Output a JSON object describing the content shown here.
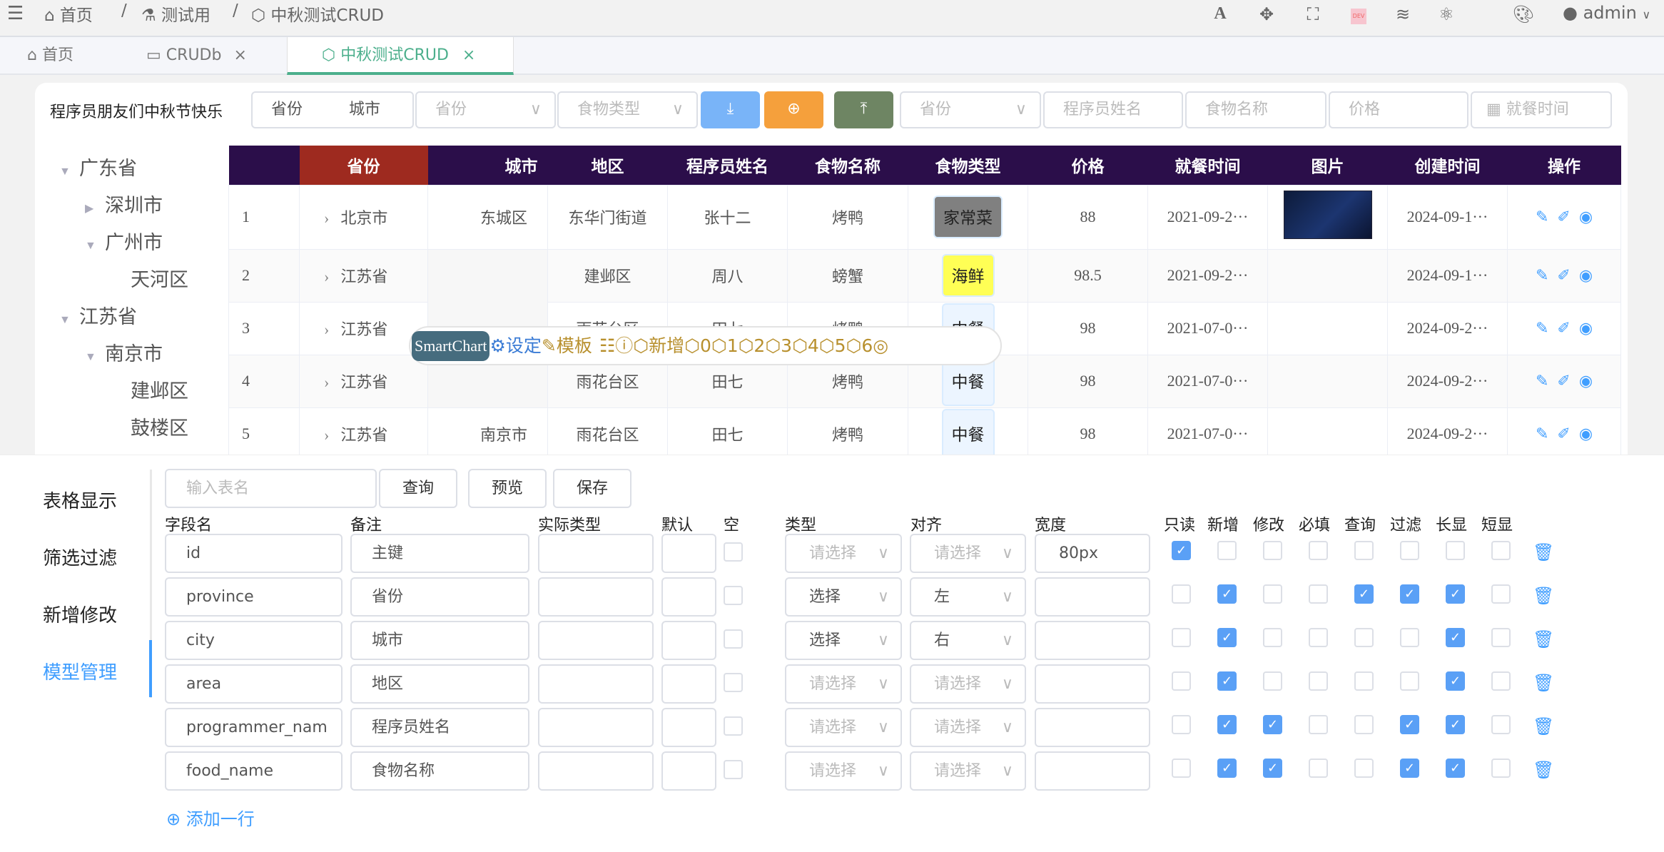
{
  "topbar": {
    "breadcrumb": [
      {
        "label": "首页",
        "icon": "home-icon"
      },
      {
        "label": "测试用",
        "icon": "flask-icon"
      },
      {
        "label": "中秋测试CRUD",
        "icon": "hexagon-icon"
      }
    ],
    "separator": "/",
    "user": "admin",
    "dev_badge": "DEV"
  },
  "tabs": [
    {
      "label": "首页",
      "icon": "home-icon"
    },
    {
      "label": "CRUDb",
      "icon": "monitor-icon",
      "close": "×"
    },
    {
      "label": "中秋测试CRUD",
      "icon": "hexagon-icon",
      "close": "×",
      "active": true
    }
  ],
  "filter": {
    "title": "程序员朋友们中秋节快乐",
    "seg": [
      "省份",
      "城市"
    ],
    "province_select": "省份",
    "food_type_select": "食物类型",
    "province_select2": "省份",
    "programmer_placeholder": "程序员姓名",
    "food_placeholder": "食物名称",
    "price_placeholder": "价格",
    "date_placeholder": "就餐时间",
    "colors": {
      "download": "#79b4f8",
      "add": "#f5a03c",
      "upload": "#6e8563"
    }
  },
  "tree": [
    {
      "label": "广东省",
      "level": 0,
      "arrow": "down"
    },
    {
      "label": "深圳市",
      "level": 1,
      "arrow": "right"
    },
    {
      "label": "广州市",
      "level": 1,
      "arrow": "down"
    },
    {
      "label": "天河区",
      "level": 2
    },
    {
      "label": "江苏省",
      "level": 0,
      "arrow": "down"
    },
    {
      "label": "南京市",
      "level": 1,
      "arrow": "down"
    },
    {
      "label": "建邺区",
      "level": 2
    },
    {
      "label": "鼓楼区",
      "level": 2
    }
  ],
  "table": {
    "headers": [
      "",
      "省份",
      "城市",
      "地区",
      "程序员姓名",
      "食物名称",
      "食物类型",
      "价格",
      "就餐时间",
      "图片",
      "创建时间",
      "操作"
    ],
    "header_color": "#2b0e4a",
    "province_header_color": "#9e2a1f",
    "rows": [
      {
        "idx": "1",
        "province": "北京市",
        "city": "东城区",
        "area": "东华门街道",
        "name": "张十二",
        "food": "烤鸭",
        "type": "家常菜",
        "type_color": "#808080",
        "price": "88",
        "meal": "2021-09-2···",
        "image": true,
        "created": "2024-09-1···"
      },
      {
        "idx": "2",
        "province": "江苏省",
        "city": "",
        "area": "建邺区",
        "name": "周八",
        "food": "螃蟹",
        "type": "海鲜",
        "type_color": "#ffff55",
        "price": "98.5",
        "meal": "2021-09-2···",
        "image": false,
        "created": "2024-09-1···"
      },
      {
        "idx": "3",
        "province": "江苏省",
        "city": "",
        "area": "雨花台区",
        "name": "田七",
        "food": "烤鸭",
        "type": "中餐",
        "type_color": "#ecf5ff",
        "price": "98",
        "meal": "2021-07-0···",
        "image": false,
        "created": "2024-09-2···"
      },
      {
        "idx": "4",
        "province": "江苏省",
        "city": "",
        "area": "雨花台区",
        "name": "田七",
        "food": "烤鸭",
        "type": "中餐",
        "type_color": "#ecf5ff",
        "price": "98",
        "meal": "2021-07-0···",
        "image": false,
        "created": "2024-09-2···"
      },
      {
        "idx": "5",
        "province": "江苏省",
        "city": "南京市",
        "area": "雨花台区",
        "name": "田七",
        "food": "烤鸭",
        "type": "中餐",
        "type_color": "#ecf5ff",
        "price": "98",
        "meal": "2021-07-0···",
        "image": false,
        "created": "2024-09-2···"
      }
    ]
  },
  "smartchart": {
    "badge": "SmartChart",
    "settings": "设定",
    "template": "模板",
    "add": "新增",
    "slots": [
      "0",
      "1",
      "2",
      "3",
      "4",
      "5",
      "6"
    ]
  },
  "panel": {
    "menu": [
      {
        "label": "表格显示"
      },
      {
        "label": "筛选过滤"
      },
      {
        "label": "新增修改"
      },
      {
        "label": "模型管理",
        "active": true
      }
    ],
    "table_name_placeholder": "输入表名",
    "query": "查询",
    "preview": "预览",
    "save": "保存",
    "headers": [
      "字段名",
      "备注",
      "实际类型",
      "默认",
      "空",
      "类型",
      "对齐",
      "宽度",
      "只读",
      "新增",
      "修改",
      "必填",
      "查询",
      "过滤",
      "长显",
      "短显"
    ],
    "select_placeholder": "请选择",
    "fields": [
      {
        "name": "id",
        "remark": "主键",
        "type": "",
        "align": "",
        "width": "80px",
        "checks": [
          true,
          false,
          false,
          false,
          false,
          false,
          false,
          false
        ]
      },
      {
        "name": "province",
        "remark": "省份",
        "type": "选择",
        "align": "左",
        "width": "",
        "checks": [
          false,
          true,
          false,
          false,
          true,
          true,
          true,
          false
        ]
      },
      {
        "name": "city",
        "remark": "城市",
        "type": "选择",
        "align": "右",
        "width": "",
        "checks": [
          false,
          true,
          false,
          false,
          false,
          false,
          true,
          false
        ]
      },
      {
        "name": "area",
        "remark": "地区",
        "type": "",
        "align": "",
        "width": "",
        "checks": [
          false,
          true,
          false,
          false,
          false,
          false,
          true,
          false
        ]
      },
      {
        "name": "programmer_nam",
        "remark": "程序员姓名",
        "type": "",
        "align": "",
        "width": "",
        "checks": [
          false,
          true,
          true,
          false,
          false,
          true,
          true,
          false
        ]
      },
      {
        "name": "food_name",
        "remark": "食物名称",
        "type": "",
        "align": "",
        "width": "",
        "checks": [
          false,
          true,
          true,
          false,
          false,
          true,
          true,
          false
        ]
      }
    ],
    "add_row": "添加一行",
    "accent": "#409eff"
  }
}
